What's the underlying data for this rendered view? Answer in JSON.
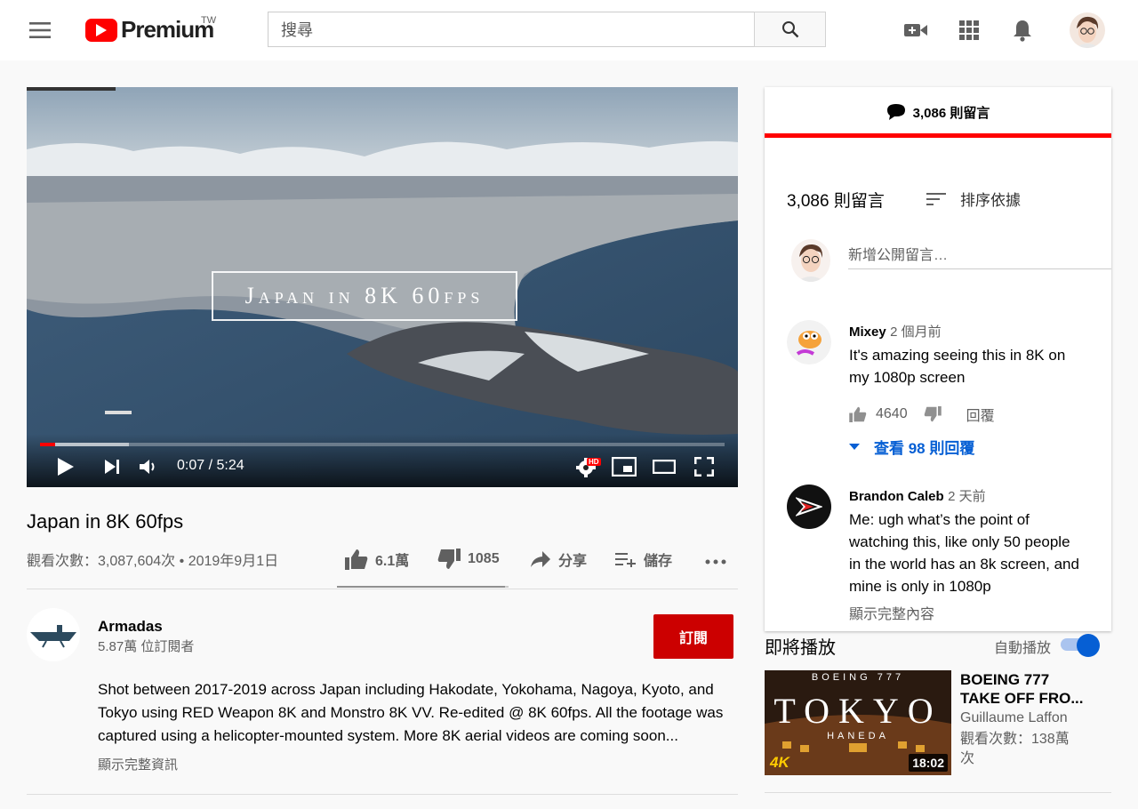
{
  "masthead": {
    "brand": "Premium",
    "region": "TW",
    "search_placeholder": "搜尋"
  },
  "player": {
    "overlay_title": "Japan in 8K 60fps",
    "current_time": "0:07",
    "separator": "/",
    "duration": "5:24",
    "progress_played_fraction": 0.022,
    "progress_buffered_fraction": 0.13,
    "hd_badge": "HD"
  },
  "video": {
    "title": "Japan in 8K 60fps",
    "views": "觀看次數：3,087,604次",
    "bullet": "•",
    "date": "2019年9月1日",
    "likes": "6.1萬",
    "dislikes": "1085",
    "share_label": "分享",
    "save_label": "儲存",
    "like_fraction": 0.98
  },
  "channel": {
    "name": "Armadas",
    "subscribers": "5.87萬 位訂閱者",
    "subscribe_label": "訂閱",
    "description_line1": "Shot between 2017-2019 across Japan including Hakodate, Yokohama, Nagoya, Kyoto, and",
    "description_line2": "Tokyo  using RED Weapon 8K and Monstro 8K VV. Re-edited @ 8K 60fps. All the footage was",
    "description_line3": "captured using a helicopter-mounted system. More 8K aerial videos are coming soon...",
    "show_more": "顯示完整資訊"
  },
  "comments": {
    "tab_label": "3,086 則留言",
    "count_label": "3,086 則留言",
    "sort_label": "排序依據",
    "add_placeholder": "新增公開留言…",
    "items": [
      {
        "author": "Mixey",
        "time": "2 個月前",
        "line1": "It's amazing seeing this in 8K on",
        "line2": "my  1080p screen",
        "likes": "4640",
        "reply_label": "回覆",
        "view_replies": "查看 98 則回覆"
      },
      {
        "author": "Brandon Caleb",
        "time": "2 天前",
        "line1": "Me: ugh what’s the point of",
        "line2": "watching this, like only 50 people",
        "line3": "in the world has an 8k screen, and",
        "line4": "mine is only in 1080p",
        "show_more": "顯示完整內容"
      }
    ]
  },
  "upnext": {
    "label": "即將播放",
    "autoplay_label": "自動播放",
    "autoplay_on": true,
    "video": {
      "title_line1": "BOEING 777",
      "title_line2": "TAKE OFF FRO...",
      "channel": "Guillaume Laffon",
      "views_line1": "觀看次數：138萬",
      "views_line2": "次",
      "duration": "18:02",
      "thumb_top": "BOEING 777",
      "thumb_main": "TOKYO",
      "thumb_sub": "HANEDA",
      "thumb_badge": "4K"
    }
  },
  "colors": {
    "brand_red": "#ff0000",
    "subscribe_red": "#cc0000",
    "link_blue": "#065fd4",
    "toggle_blue": "#065fd4"
  }
}
